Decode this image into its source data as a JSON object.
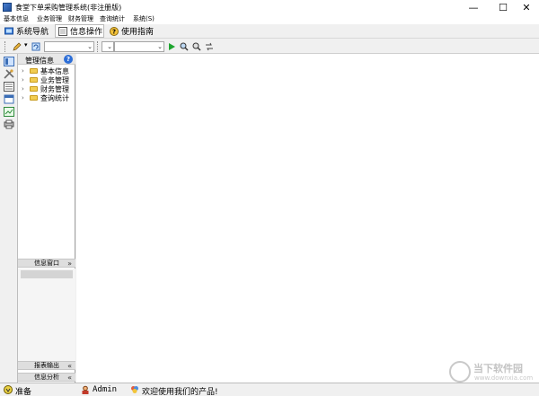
{
  "window": {
    "title": "食堂下单采购管理系统(非注册版)",
    "minimize": "—",
    "maximize": "☐",
    "close": "✕"
  },
  "menu": [
    "基本信息",
    "业务管理",
    "财务管理",
    "查询统计",
    "系统(S)"
  ],
  "nav": [
    {
      "label": "系统导航",
      "icon": "nav-icon"
    },
    {
      "label": "信息操作",
      "icon": "info-icon"
    },
    {
      "label": "使用指南",
      "icon": "help-icon"
    }
  ],
  "tree": {
    "header": "管理信息",
    "items": [
      "基本信息",
      "业务管理",
      "财务管理",
      "查询统计"
    ]
  },
  "panels": {
    "info_window": "信息窗口",
    "report_output": "报表输出",
    "info_analysis": "信息分析"
  },
  "status": {
    "ready": "准备",
    "user": "Admin",
    "message": "欢迎使用我们的产品!"
  },
  "watermark": {
    "name": "当下软件园",
    "url": "www.downxia.com"
  },
  "colors": {
    "accent": "#2d6ed7",
    "folder": "#f2cd52",
    "play": "#1ea52f"
  }
}
